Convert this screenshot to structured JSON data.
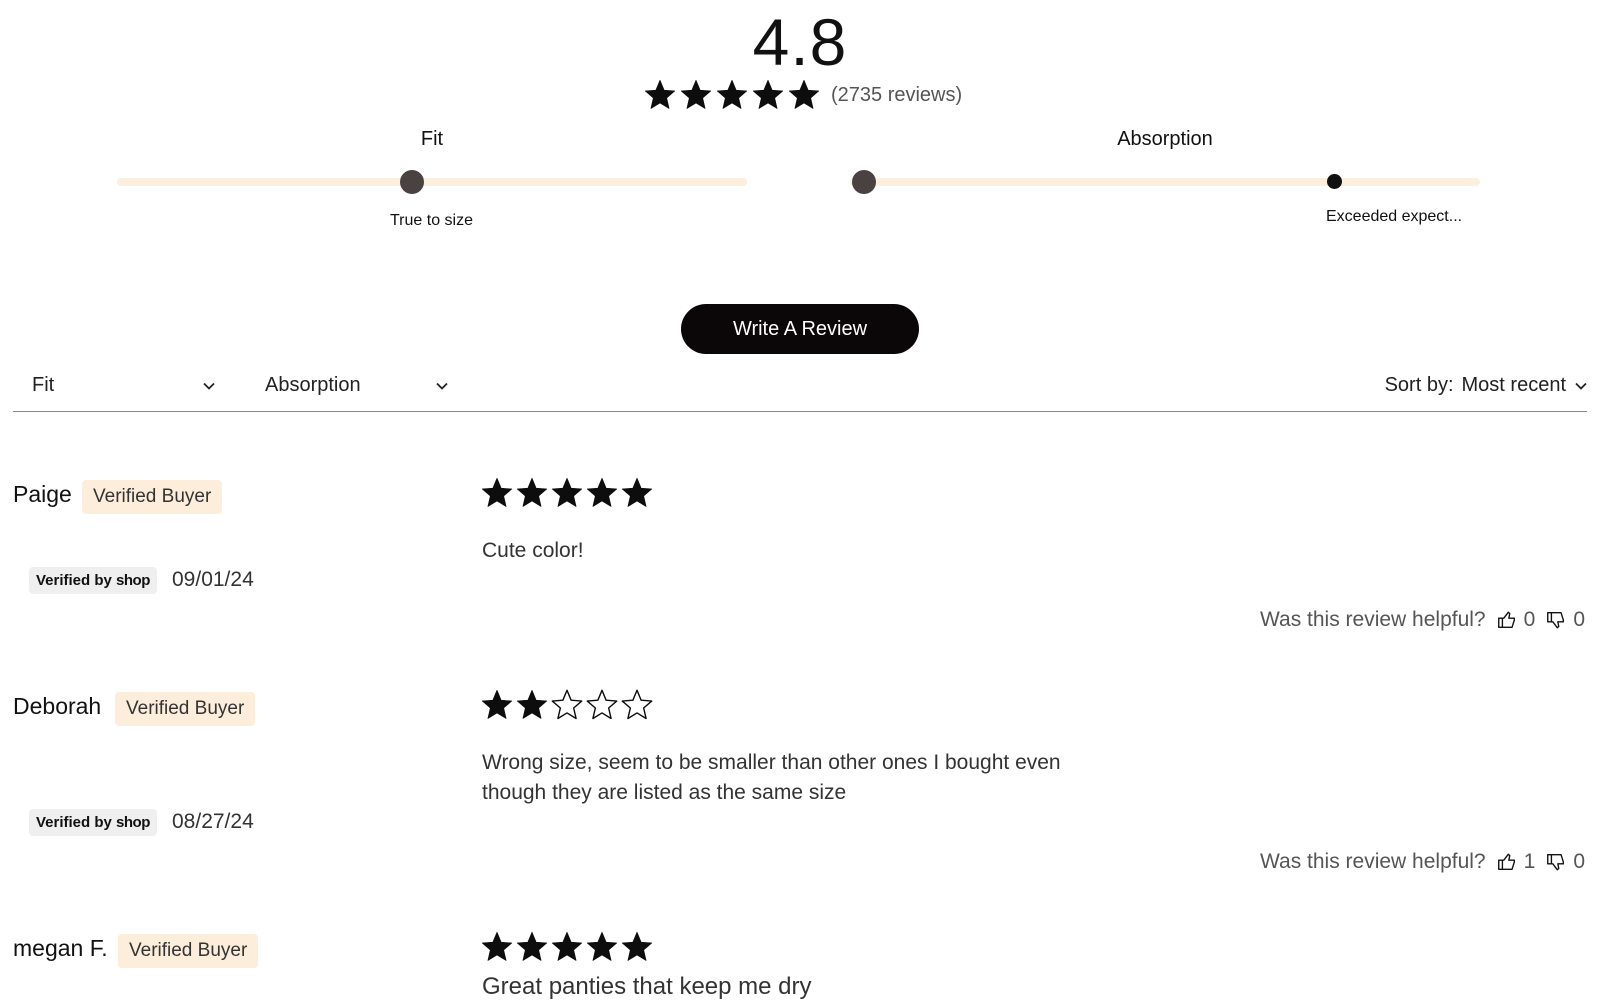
{
  "summary": {
    "average_rating": "4.8",
    "star_rating": 5,
    "review_count_label": "(2735 reviews)"
  },
  "fit_slider": {
    "title": "Fit",
    "caption": "True to size",
    "level": 0.47
  },
  "absorption_slider": {
    "title": "Absorption",
    "caption": "Exceeded expect...",
    "level": 0.77
  },
  "write_review": {
    "label": "Write A Review"
  },
  "filters": {
    "fit_label": "Fit",
    "absorption_label": "Absorption",
    "sort_prefix": "Sort by:",
    "sort_value": "Most recent"
  },
  "reviews": [
    {
      "name": "Paige",
      "badge": "Verified Buyer",
      "verified_by": "Verified by",
      "shop_word": "shop",
      "date": "09/01/24",
      "rating": 5,
      "text": "Cute color!",
      "helpful_label": "Was this review helpful?",
      "up_count": "0",
      "down_count": "0"
    },
    {
      "name": "Deborah",
      "badge": "Verified Buyer",
      "verified_by": "Verified by",
      "shop_word": "shop",
      "date": "08/27/24",
      "rating": 2,
      "text": "Wrong size, seem to be smaller than other ones I bought even though they are listed as the same size",
      "helpful_label": "Was this review helpful?",
      "up_count": "1",
      "down_count": "0"
    },
    {
      "name": "megan F.",
      "badge": "Verified Buyer",
      "rating": 5,
      "text": "Great panties that keep me dry"
    }
  ],
  "icons": {
    "star": "star-icon",
    "chevron": "chevron-down-icon",
    "thumbs_up": "thumbs-up-icon",
    "thumbs_down": "thumbs-down-icon"
  },
  "colors": {
    "accent_bg": "#fdeedb",
    "slider_track": "#fcefdd",
    "button_bg": "#0b0607",
    "star_fill": "#0d0d0d"
  }
}
